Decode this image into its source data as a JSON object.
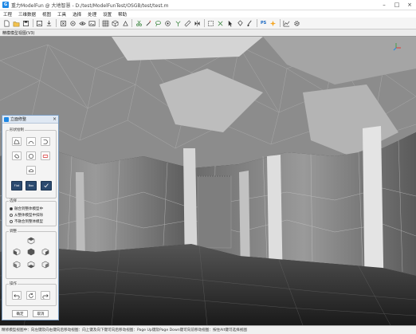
{
  "window": {
    "title": "重力ModelFun @ 大地智慧 - D:/test/ModelFunTest/OSGB/test/test.m",
    "app_icon": "app-logo-icon",
    "controls": [
      "minimize-icon",
      "maximize-icon",
      "close-icon"
    ]
  },
  "menu": [
    "工程",
    "三维数据",
    "视图",
    "工具",
    "选择",
    "处理",
    "设置",
    "帮助"
  ],
  "toolbar": {
    "icons": [
      "new-file-icon",
      "open-folder-icon",
      "save-icon",
      "separator",
      "save-as-icon",
      "import-icon",
      "separator",
      "close-model-icon",
      "view-icon",
      "eye-icon",
      "image-icon",
      "separator",
      "grid-icon",
      "cube-icon",
      "shape-icon",
      "separator",
      "cut-icon",
      "wand-icon",
      "lasso-icon",
      "hole-icon",
      "merge-icon",
      "measure-icon",
      "flip-icon",
      "separator",
      "box-select-icon",
      "crossing-icon",
      "arrow-select-icon",
      "bucket-icon",
      "brush-icon",
      "separator",
      "ps-icon",
      "magic-icon",
      "separator",
      "chart-icon",
      "gear-icon"
    ],
    "ps_label": "PS"
  },
  "doc_tab": {
    "label": "精模模型视图(V3)"
  },
  "viewport": {
    "axis_colors": {
      "x": "#e53935",
      "y": "#43a047",
      "z": "#1e88e5"
    }
  },
  "panel": {
    "title": "立面修整",
    "close": "×",
    "group_shape": "形状绘制",
    "group_select": "选择",
    "radio_options": [
      "融合到整体模型中",
      "从整体模型中扣除",
      "不融合到整体模型"
    ],
    "radio_selected": 0,
    "group_adjust": "调整",
    "group_ops": "操作",
    "confirm": "确定",
    "cancel": "取消",
    "tiny_labels": [
      "Flat",
      "Box"
    ]
  },
  "status": {
    "text": "精修模型视图中：向左键及向右键向后移动视图：向上键及向下键可向后移动视图：Page Up键及Page Down键可向前移动视图：按住Alt键可选择视图"
  }
}
